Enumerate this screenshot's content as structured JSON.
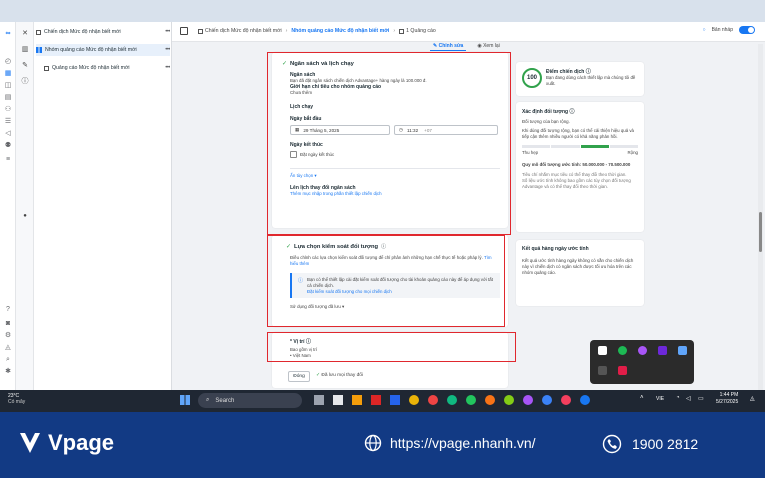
{
  "header": {
    "campaign_crumb": "Chiến dịch Mức độ nhận biết mới",
    "adset_crumb": "Nhóm quảng cáo Mức độ nhận biết mới",
    "ads_crumb": "1 Quảng cáo",
    "draft_label": "Bản nháp"
  },
  "subtabs": {
    "edit": "Chỉnh sửa",
    "preview": "Xem lại"
  },
  "tree": {
    "campaign": "Chiến dịch Mức độ nhận biết mới",
    "adset": "Nhóm quảng cáo Mức độ nhận biết mới",
    "ad": "Quảng cáo Mức độ nhận biết mới"
  },
  "budget": {
    "title": "Ngân sách và lịch chạy",
    "budget_label": "Ngân sách",
    "budget_desc": "Bạn đã đặt ngân sách chiến dịch Advantage+ hàng ngày là 100.000 đ.",
    "limit_label": "Giới hạn chi tiêu cho nhóm quảng cáo",
    "limit_value": "Chưa thêm",
    "schedule_label": "Lịch chạy",
    "start_label": "Ngày bắt đầu",
    "start_date": "29 Tháng 5, 2025",
    "start_time": "11:32",
    "tz": "+07",
    "end_label": "Ngày kết thúc",
    "end_checkbox": "Đặt ngày kết thúc",
    "more_options": "Ẩn tùy chọn",
    "spend_schedule_label": "Lên lịch thay đổi ngân sách",
    "spend_schedule_link": "Thêm mục nhập trong phần thiết lập chiến dịch"
  },
  "audience": {
    "title": "Lựa chọn kiểm soát đối tượng",
    "desc": "Điều chỉnh các lựa chọn kiểm soát đối tượng để chỉ phân ảnh những hạn chế thực tế hoặc pháp lý.",
    "learn_more": "Tìm hiểu thêm",
    "info_text": "Bạn có thể thiết lập cài đặt kiểm soát đối tượng cho tài khoản quảng cáo này để áp dụng với tất cả chiến dịch.",
    "info_link": "Đặt kiểm soát đối tượng cho mọi chiến dịch",
    "use_audience": "Sử dụng đối tượng đã lưu"
  },
  "placement": {
    "title": "Vị trí",
    "include_label": "Bao gồm vị trí",
    "country": "Việt Nam"
  },
  "footer": {
    "done": "Đóng",
    "saved": "Đã lưu mọi thay đổi"
  },
  "score": {
    "value": "100",
    "title": "Điểm chiến dịch",
    "desc": "Bạn đang dùng cách thiết lập mà chúng tôi đề xuất."
  },
  "audience_def": {
    "title": "Xác định đối tượng",
    "sub": "Đối tượng của bạn rộng.",
    "desc": "Khi dùng đối tượng rộng, bạn có thể cải thiện hiệu quả và tiếp cận thêm nhiều người có khả năng phản hồi.",
    "narrow": "Thu hẹp",
    "broad": "Rộng",
    "size": "Quy mô đối tượng ước tính: 50.000.000 - 70.500.000",
    "note1": "Tiêu chí nhắm mục tiêu có thể thay đổi theo thời gian.",
    "note2": "Số liệu ước tính không bao gồm các tùy chọn đối tượng Advantage và có thể thay đổi theo thời gian."
  },
  "results": {
    "title": "Kết quả hàng ngày ước tính",
    "desc": "Kết quả ước tính hàng ngày không có sẵn cho chiến dịch này vì chiến dịch có ngân sách được tối ưu hóa trên các nhóm quảng cáo."
  },
  "taskbar": {
    "temp": "23°C",
    "weather": "Có mây",
    "search": "Search",
    "lang": "VIE",
    "time": "1:44 PM",
    "date": "5/27/2025"
  },
  "banner": {
    "brand": "Vpage",
    "url": "https://vpage.nhanh.vn/",
    "phone": "1900 2812"
  },
  "colors": {
    "accent": "#1877f2",
    "red_highlight": "#e0282e",
    "banner": "#123a84"
  }
}
